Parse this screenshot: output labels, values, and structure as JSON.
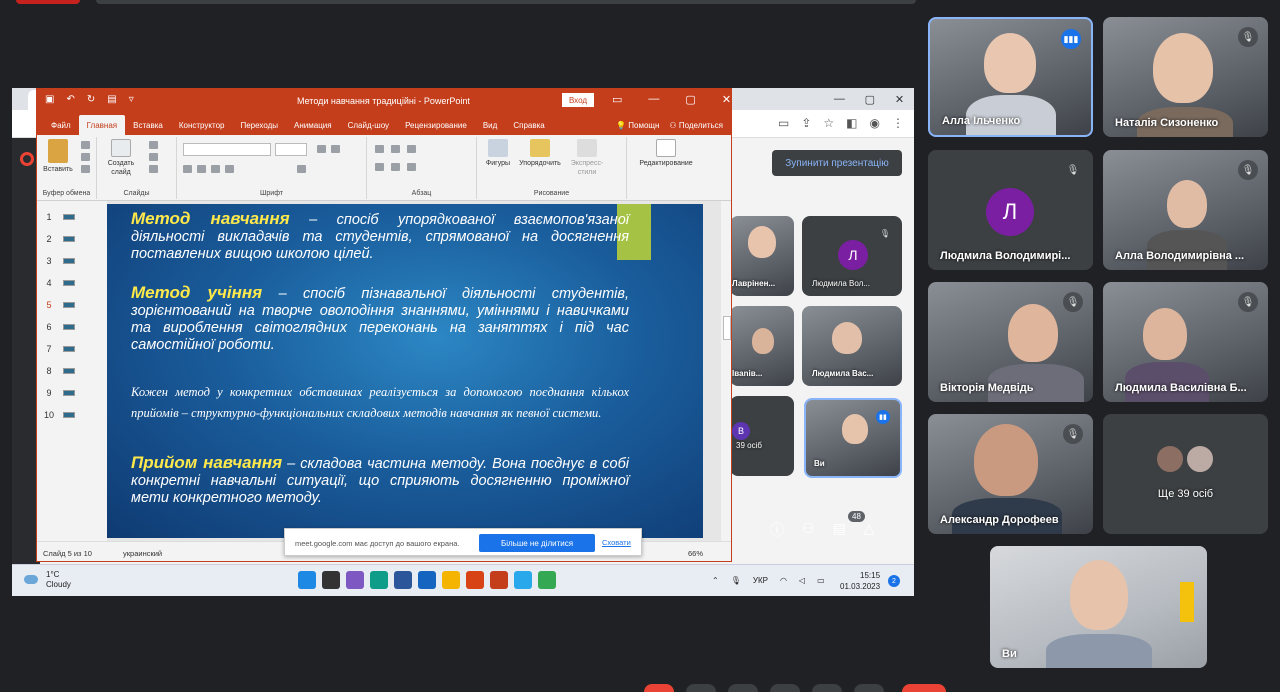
{
  "ppt": {
    "title": "Методи навчання традиційні  -  PowerPoint",
    "login": "Вход",
    "tabs": [
      "Файл",
      "Главная",
      "Вставка",
      "Конструктор",
      "Переходы",
      "Анимация",
      "Слайд-шоу",
      "Рецензирование",
      "Вид",
      "Справка"
    ],
    "help_label": "Помощн",
    "share_label": "Поделиться",
    "ribbon": {
      "paste": "Вставить",
      "new_slide": "Создать слайд",
      "clipboard_group": "Буфер обмена",
      "slides_group": "Слайды",
      "font_group": "Шрифт",
      "paragraph_group": "Абзац",
      "shapes": "Фигуры",
      "arrange": "Упорядочить",
      "express": "Экспресс-стили",
      "drawing_group": "Рисование",
      "editing": "Редактирование"
    },
    "thumbnails": [
      "1",
      "2",
      "3",
      "4",
      "5",
      "6",
      "7",
      "8",
      "9",
      "10"
    ],
    "active_thumb": 4,
    "slide": {
      "p1_kw": "Метод навчання",
      "p1_text": " – спосіб упорядкованої взаємопов'язаної діяльності викладачів та студентів, спрямованої на досягнення поставлених вищою школою цілей.",
      "p2_kw": "Метод учіння",
      "p2_text": " – спосіб пізнавальної діяльності студентів, зорієнтований на творче оволодіння знаннями, уміннями і навичками та вироблення світоглядних переконань на заняттях і під час самостійної роботи.",
      "p3_text": "Кожен метод у  конкретних обставинах реалізується за допомогою поєднання кількох прийомів – структурно-функціональних складових методів навчання як певної системи.",
      "p4_kw": "Прийом навчання",
      "p4_text": " – складова частина методу. Вона поєднує в собі конкретні навчальні ситуації, що сприяють досягненню проміжної мети конкретного методу."
    },
    "status": {
      "slide": "Слайд 5 из 10",
      "lang": "украинский",
      "zoom": "66%"
    }
  },
  "notice": {
    "message": "meet.google.com має доступ до вашого екрана.",
    "stop": "Більше не ділитися",
    "hide": "Сховати"
  },
  "stop_presenting": "Зупинити презентацію",
  "taskbar": {
    "temp": "1°C",
    "weather": "Cloudy",
    "lang": "УКР",
    "time": "15:15",
    "date": "01.03.2023",
    "notif": "2"
  },
  "participants": {
    "alla_ilchenko": "Алла Ільченко",
    "natalia": "Наталія Сизоненко",
    "ludmyla_v": "Людмила Володимирі...",
    "ludmyla_v_initial": "Л",
    "alla_vol": "Алла Володимирівна ...",
    "viktoria": "Вікторія Медвідь",
    "ludmyla_vas": "Людмила Василівна Б...",
    "alexander": "Александр Дорофеев",
    "more": "Ще 39 осіб",
    "self": "Ви"
  },
  "shared_tiles": {
    "t1": "Лаврінен...",
    "t2": "Людмила Вол...",
    "t2_initial": "Л",
    "t3": "Івanів...",
    "t4": "Людмила Вас...",
    "t5": "39 осіб",
    "t5_initial": "В",
    "t6": "Ви"
  },
  "meet_controls": {
    "count": "48"
  }
}
